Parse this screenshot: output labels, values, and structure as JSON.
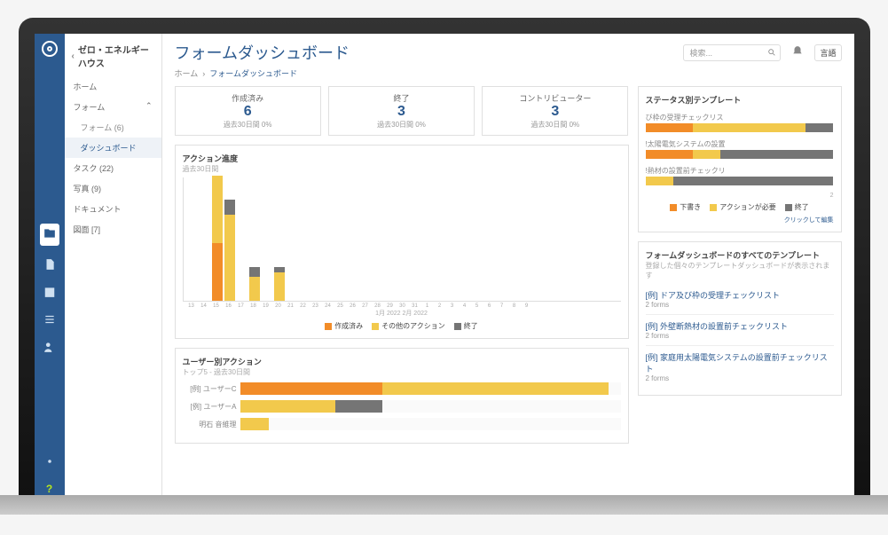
{
  "project_name": "ゼロ・エネルギーハウス",
  "page_title": "フォームダッシュボード",
  "breadcrumbs": {
    "home": "ホーム",
    "current": "フォームダッシュボード"
  },
  "search_placeholder": "検索...",
  "lang_button": "言語",
  "nav": {
    "home": "ホーム",
    "forms": "フォーム",
    "forms_count": "フォーム (6)",
    "dashboard": "ダッシュボード",
    "tasks": "タスク (22)",
    "photos": "写真 (9)",
    "documents": "ドキュメント",
    "drawings": "図面 [7]"
  },
  "stats": {
    "created": {
      "label": "作成済み",
      "value": "6",
      "sub": "過去30日間 0%"
    },
    "closed": {
      "label": "終了",
      "value": "3",
      "sub": "過去30日間 0%"
    },
    "contributors": {
      "label": "コントリビューター",
      "value": "3",
      "sub": "過去30日間 0%"
    }
  },
  "progress": {
    "title": "アクション進度",
    "subtitle": "過去30日間",
    "x_axis_title": "1月 2022  2月 2022",
    "legend": {
      "created": "作成済み",
      "other": "その他のアクション",
      "closed": "終了"
    }
  },
  "user_actions": {
    "title": "ユーザー別アクション",
    "subtitle": "トップ5 - 過去30日間",
    "rows": [
      {
        "name": "[例] ユーザーC"
      },
      {
        "name": "[例] ユーザーA"
      },
      {
        "name": "明石 音維理"
      }
    ]
  },
  "status_templates": {
    "title": "ステータス別テンプレート",
    "rows": [
      {
        "name": "び枠の受理チェックリス"
      },
      {
        "name": "!太陽電気システムの設置"
      },
      {
        "name": "!熱材の設置前チェックリ"
      }
    ],
    "legend": {
      "draft": "下書き",
      "action": "アクションが必要",
      "closed": "終了"
    },
    "edit": "クリックして編集"
  },
  "all_templates": {
    "title": "フォームダッシュボードのすべてのテンプレート",
    "subtitle": "登録した個々のテンプレートダッシュボードが表示されます",
    "items": [
      {
        "name": "[例] ドア及び枠の受理チェックリスト",
        "count": "2 forms"
      },
      {
        "name": "[例] 外壁断熱材の設置前チェックリスト",
        "count": "2 forms"
      },
      {
        "name": "[例] 家庭用太陽電気システムの設置前チェックリスト",
        "count": "2 forms"
      }
    ]
  },
  "chart_data": [
    {
      "type": "bar",
      "title": "アクション進度",
      "xlabel": "1月 2022  2月 2022",
      "categories": [
        "13",
        "14",
        "15",
        "16",
        "17",
        "18",
        "19",
        "20",
        "21",
        "22",
        "23",
        "24",
        "25",
        "26",
        "27",
        "28",
        "29",
        "30",
        "31",
        "1",
        "2",
        "3",
        "4",
        "5",
        "6",
        "7",
        "8",
        "9"
      ],
      "series": [
        {
          "name": "作成済み",
          "values": [
            0,
            0,
            6,
            0,
            0,
            0,
            0,
            0,
            0,
            0,
            0,
            0,
            0,
            0,
            0,
            0,
            0,
            0,
            0,
            0,
            0,
            0,
            0,
            0,
            0,
            0,
            0,
            0
          ]
        },
        {
          "name": "その他のアクション",
          "values": [
            0,
            0,
            7,
            9,
            0,
            2.5,
            0,
            3,
            0,
            0,
            0,
            0,
            0,
            0,
            0,
            0,
            0,
            0,
            0,
            0,
            0,
            0,
            0,
            0,
            0,
            0,
            0,
            0
          ]
        },
        {
          "name": "終了",
          "values": [
            0,
            0,
            0,
            1.5,
            0,
            1,
            0,
            0.5,
            0,
            0,
            0,
            0,
            0,
            0,
            0,
            0,
            0,
            0,
            0,
            0,
            0,
            0,
            0,
            0,
            0,
            0,
            0,
            0
          ]
        }
      ],
      "ylim": [
        0,
        12
      ]
    },
    {
      "type": "bar",
      "orientation": "horizontal",
      "title": "ユーザー別アクション",
      "categories": [
        "[例] ユーザーC",
        "[例] ユーザーA",
        "明石 音維理"
      ],
      "series": [
        {
          "name": "作成済み",
          "values": [
            6,
            0,
            0
          ]
        },
        {
          "name": "その他のアクション",
          "values": [
            9.5,
            4,
            1.2
          ]
        },
        {
          "name": "終了",
          "values": [
            0,
            2,
            0
          ]
        }
      ],
      "xlim": [
        0,
        16
      ]
    },
    {
      "type": "bar",
      "orientation": "horizontal",
      "title": "ステータス別テンプレート",
      "categories": [
        "び枠の受理チェックリス",
        "!太陽電気システムの設置",
        "!熱材の設置前チェックリ"
      ],
      "series": [
        {
          "name": "下書き",
          "values": [
            0.5,
            0.5,
            0
          ]
        },
        {
          "name": "アクションが必要",
          "values": [
            1.2,
            0.3,
            0.3
          ]
        },
        {
          "name": "終了",
          "values": [
            0.3,
            1.2,
            1.7
          ]
        }
      ],
      "xlim": [
        0,
        2
      ]
    }
  ]
}
